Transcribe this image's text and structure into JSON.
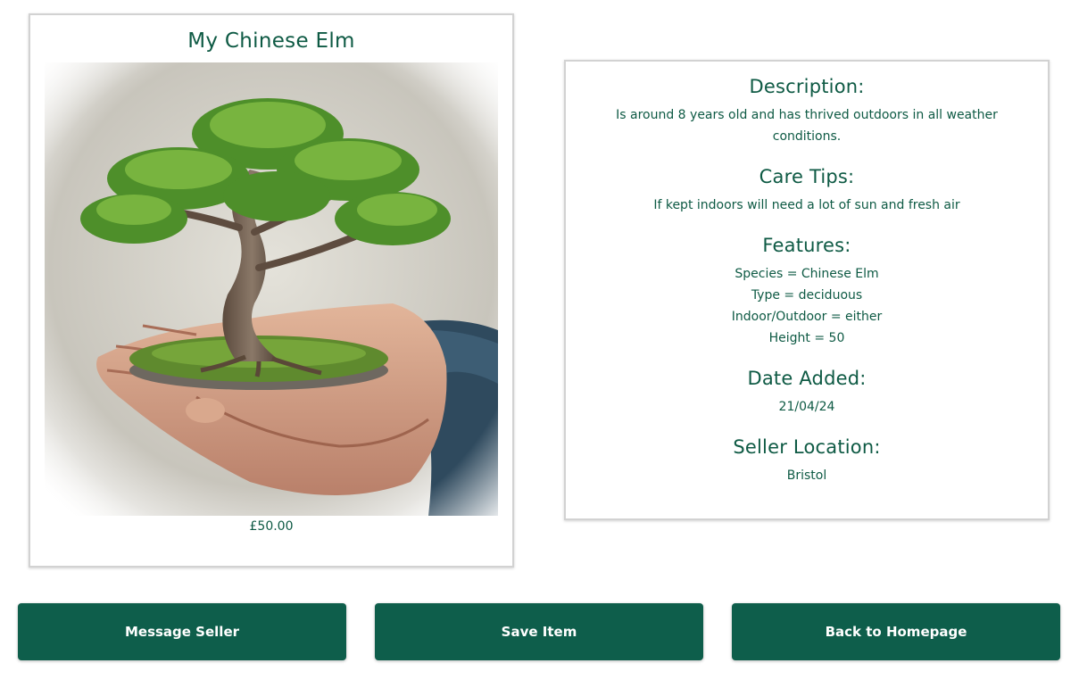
{
  "product": {
    "title": "My Chinese Elm",
    "price": "£50.00"
  },
  "details": {
    "description": {
      "heading": "Description:",
      "text": "Is around 8 years old and has thrived outdoors in all weather conditions."
    },
    "care_tips": {
      "heading": "Care Tips:",
      "text": "If kept indoors will need a lot of sun and fresh air"
    },
    "features": {
      "heading": "Features:",
      "items": [
        "Species = Chinese Elm",
        "Type = deciduous",
        "Indoor/Outdoor = either",
        "Height = 50"
      ]
    },
    "date_added": {
      "heading": "Date Added:",
      "text": "21/04/24"
    },
    "seller_location": {
      "heading": "Seller Location:",
      "text": "Bristol"
    }
  },
  "buttons": {
    "message_seller": "Message Seller",
    "save_item": "Save Item",
    "back_home": "Back to Homepage"
  },
  "colors": {
    "primary_green": "#0e5e4b",
    "text_green": "#0e5a44",
    "card_border": "#d2d2d2"
  }
}
